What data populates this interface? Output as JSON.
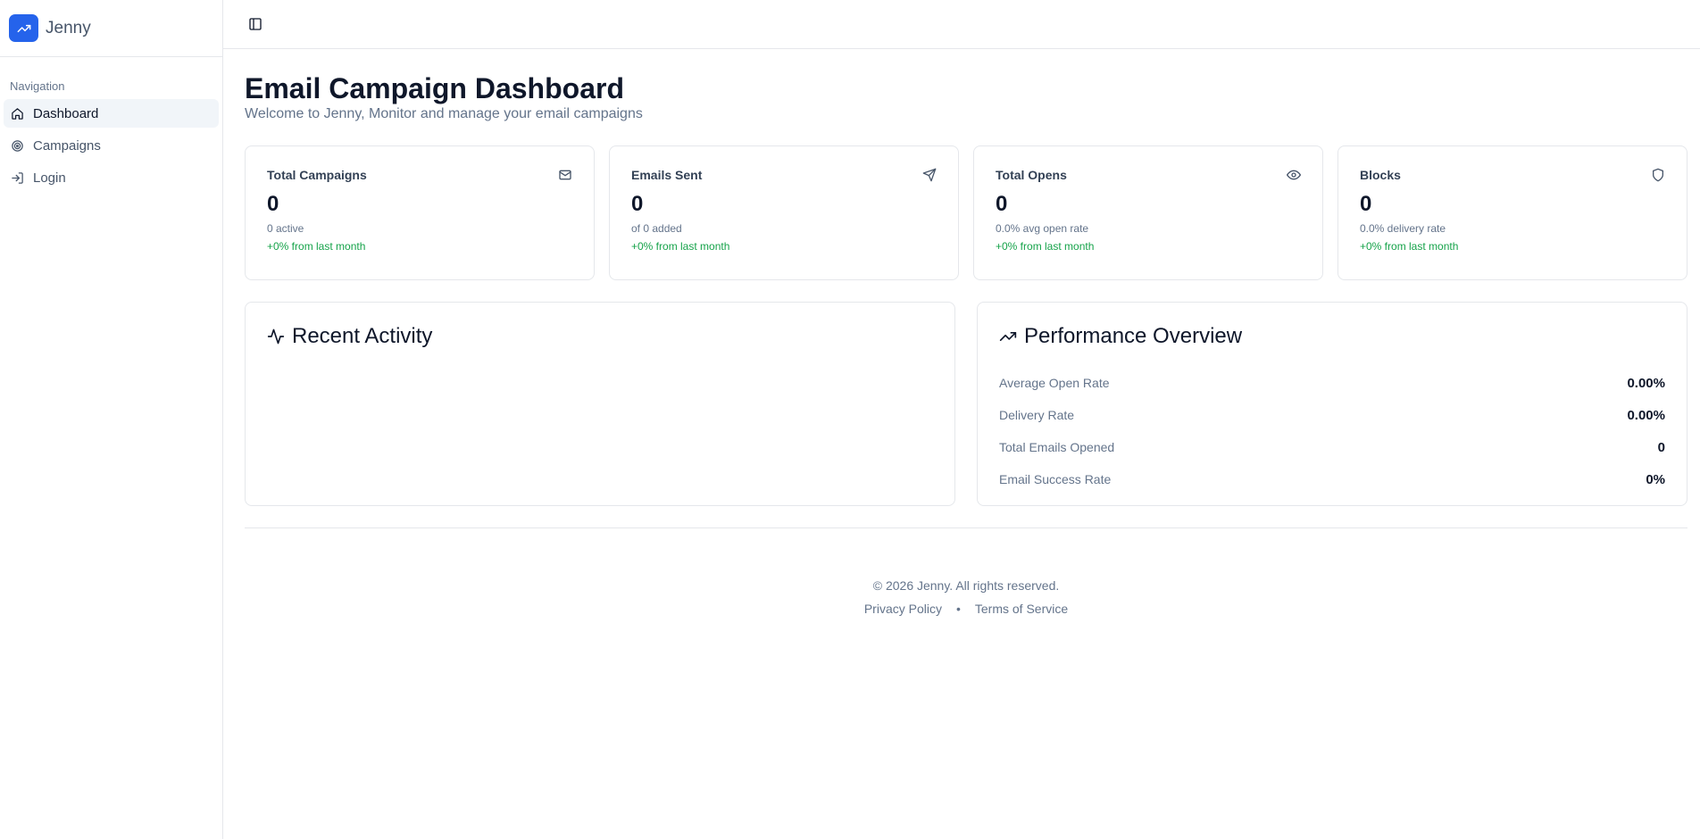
{
  "brand": {
    "name": "Jenny"
  },
  "sidebar": {
    "section_label": "Navigation",
    "items": [
      {
        "label": "Dashboard",
        "icon": "home-icon",
        "active": true
      },
      {
        "label": "Campaigns",
        "icon": "target-icon",
        "active": false
      },
      {
        "label": "Login",
        "icon": "login-icon",
        "active": false
      }
    ]
  },
  "header": {
    "title": "Email Campaign Dashboard",
    "subtitle": "Welcome to Jenny, Monitor and manage your email campaigns"
  },
  "stats": [
    {
      "title": "Total Campaigns",
      "value": "0",
      "sub": "0 active",
      "trend": "+0% from last month",
      "icon": "mail-icon"
    },
    {
      "title": "Emails Sent",
      "value": "0",
      "sub": "of 0 added",
      "trend": "+0% from last month",
      "icon": "send-icon"
    },
    {
      "title": "Total Opens",
      "value": "0",
      "sub": "0.0% avg open rate",
      "trend": "+0% from last month",
      "icon": "eye-icon"
    },
    {
      "title": "Blocks",
      "value": "0",
      "sub": "0.0% delivery rate",
      "trend": "+0% from last month",
      "icon": "shield-icon"
    }
  ],
  "recent_activity": {
    "title": "Recent Activity"
  },
  "performance": {
    "title": "Performance Overview",
    "rows": [
      {
        "label": "Average Open Rate",
        "value": "0.00%"
      },
      {
        "label": "Delivery Rate",
        "value": "0.00%"
      },
      {
        "label": "Total Emails Opened",
        "value": "0"
      },
      {
        "label": "Email Success Rate",
        "value": "0%"
      }
    ]
  },
  "footer": {
    "copyright": "© 2026 Jenny. All rights reserved.",
    "privacy": "Privacy Policy",
    "separator": "•",
    "terms": "Terms of Service"
  },
  "colors": {
    "accent": "#2563eb",
    "positive": "#16a34a",
    "muted": "#64748b"
  }
}
